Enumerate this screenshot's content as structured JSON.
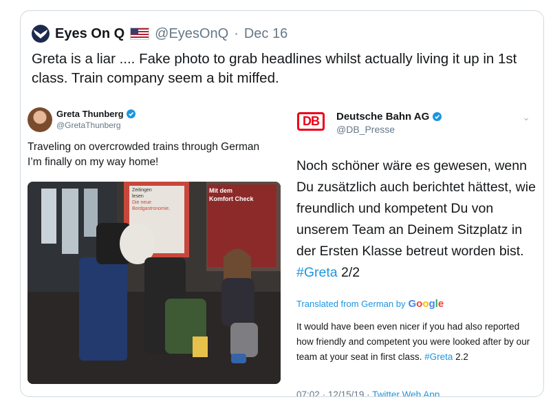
{
  "tweet": {
    "author_name": "Eyes On Q",
    "author_handle": "@EyesOnQ",
    "separator": "·",
    "date": "Dec 16",
    "text": "Greta is a liar .... Fake photo to grab headlines whilst actually living it up in 1st class. Train company seem a bit miffed.",
    "flag_icon": "us-flag-icon"
  },
  "left_screenshot": {
    "author_name": "Greta Thunberg",
    "author_handle": "@GretaThunberg",
    "text_line1": "Traveling on overcrowded trains through German",
    "text_line2": "I’m finally on my way home!",
    "photo_sign1_l1": "Zeitingen",
    "photo_sign1_l2": "lesen",
    "photo_sign1_l3": "Die neue",
    "photo_sign1_l4": "Bordgastronomie.",
    "photo_sign2_l1": "Mit dem",
    "photo_sign2_l2": "Komfort Check"
  },
  "right_screenshot": {
    "logo_text": "DB",
    "author_name": "Deutsche Bahn AG",
    "author_handle": "@DB_Presse",
    "text": "Noch schöner wäre es gewesen, wenn Du zusätzlich auch berichtet hättest, wie freundlich und kompetent Du von unserem Team an Deinem Sitzplatz in der Ersten Klasse betreut worden bist.",
    "hashtag": "#Greta",
    "suffix": "2/2",
    "translated_label": "Translated from German by",
    "google_label": "Google",
    "translation": "It would have been even nicer if you had also reported how friendly and competent you were looked after by our team at your seat in first class.",
    "translation_hashtag": "#Greta",
    "translation_suffix": "2.2",
    "time": "07:02",
    "date": "12/15/19",
    "meta_separator": "·",
    "app": "Twitter Web App"
  },
  "colors": {
    "link": "#1b95e0",
    "db_red": "#ec0016",
    "secondary_text": "#657786"
  }
}
